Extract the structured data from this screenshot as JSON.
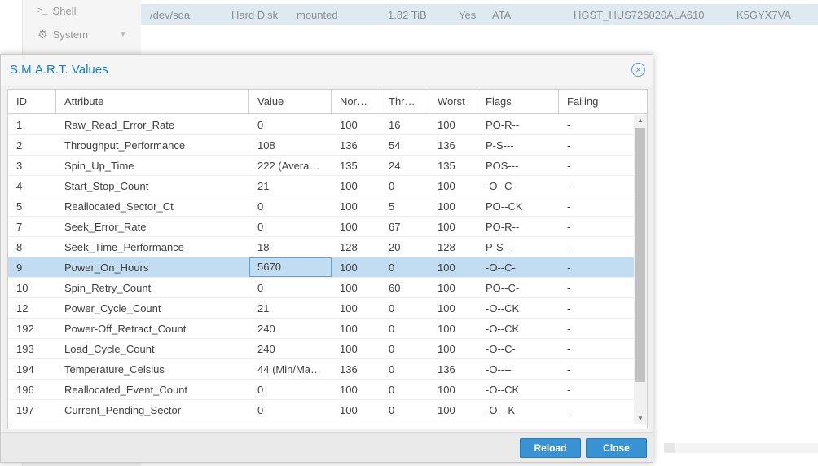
{
  "background": {
    "nav": [
      {
        "icon": "terminal-icon",
        "glyph": ">_",
        "label": "Shell"
      },
      {
        "icon": "gear-icon",
        "glyph": "⚙",
        "label": "System"
      }
    ],
    "disk_row": {
      "device": "/dev/sda",
      "type": "Hard Disk",
      "usage": "mounted",
      "size": "1.82 TiB",
      "gpt": "Yes",
      "vendor": "ATA",
      "model": "HGST_HUS726020ALA610",
      "serial": "K5GYX7VA"
    }
  },
  "dialog": {
    "title": "S.M.A.R.T. Values",
    "close_glyph": "×"
  },
  "grid": {
    "columns": [
      "ID",
      "Attribute",
      "Value",
      "Nor…",
      "Thr…",
      "Worst",
      "Flags",
      "Failing"
    ],
    "rows": [
      [
        "1",
        "Raw_Read_Error_Rate",
        "0",
        "100",
        "16",
        "100",
        "PO-R--",
        "-"
      ],
      [
        "2",
        "Throughput_Performance",
        "108",
        "136",
        "54",
        "136",
        "P-S---",
        "-"
      ],
      [
        "3",
        "Spin_Up_Time",
        "222 (Avera…",
        "135",
        "24",
        "135",
        "POS---",
        "-"
      ],
      [
        "4",
        "Start_Stop_Count",
        "21",
        "100",
        "0",
        "100",
        "-O--C-",
        "-"
      ],
      [
        "5",
        "Reallocated_Sector_Ct",
        "0",
        "100",
        "5",
        "100",
        "PO--CK",
        "-"
      ],
      [
        "7",
        "Seek_Error_Rate",
        "0",
        "100",
        "67",
        "100",
        "PO-R--",
        "-"
      ],
      [
        "8",
        "Seek_Time_Performance",
        "18",
        "128",
        "20",
        "128",
        "P-S---",
        "-"
      ],
      [
        "9",
        "Power_On_Hours",
        "5670",
        "100",
        "0",
        "100",
        "-O--C-",
        "-"
      ],
      [
        "10",
        "Spin_Retry_Count",
        "0",
        "100",
        "60",
        "100",
        "PO--C-",
        "-"
      ],
      [
        "12",
        "Power_Cycle_Count",
        "21",
        "100",
        "0",
        "100",
        "-O--CK",
        "-"
      ],
      [
        "192",
        "Power-Off_Retract_Count",
        "240",
        "100",
        "0",
        "100",
        "-O--CK",
        "-"
      ],
      [
        "193",
        "Load_Cycle_Count",
        "240",
        "100",
        "0",
        "100",
        "-O--C-",
        "-"
      ],
      [
        "194",
        "Temperature_Celsius",
        "44 (Min/Ma…",
        "136",
        "0",
        "136",
        "-O----",
        "-"
      ],
      [
        "196",
        "Reallocated_Event_Count",
        "0",
        "100",
        "0",
        "100",
        "-O--CK",
        "-"
      ],
      [
        "197",
        "Current_Pending_Sector",
        "0",
        "100",
        "0",
        "100",
        "-O---K",
        "-"
      ]
    ],
    "selected_row": 7
  },
  "buttons": {
    "reload": "Reload",
    "close": "Close"
  },
  "colors": {
    "accent": "#157fcc",
    "selection": "#c2dcf2"
  }
}
